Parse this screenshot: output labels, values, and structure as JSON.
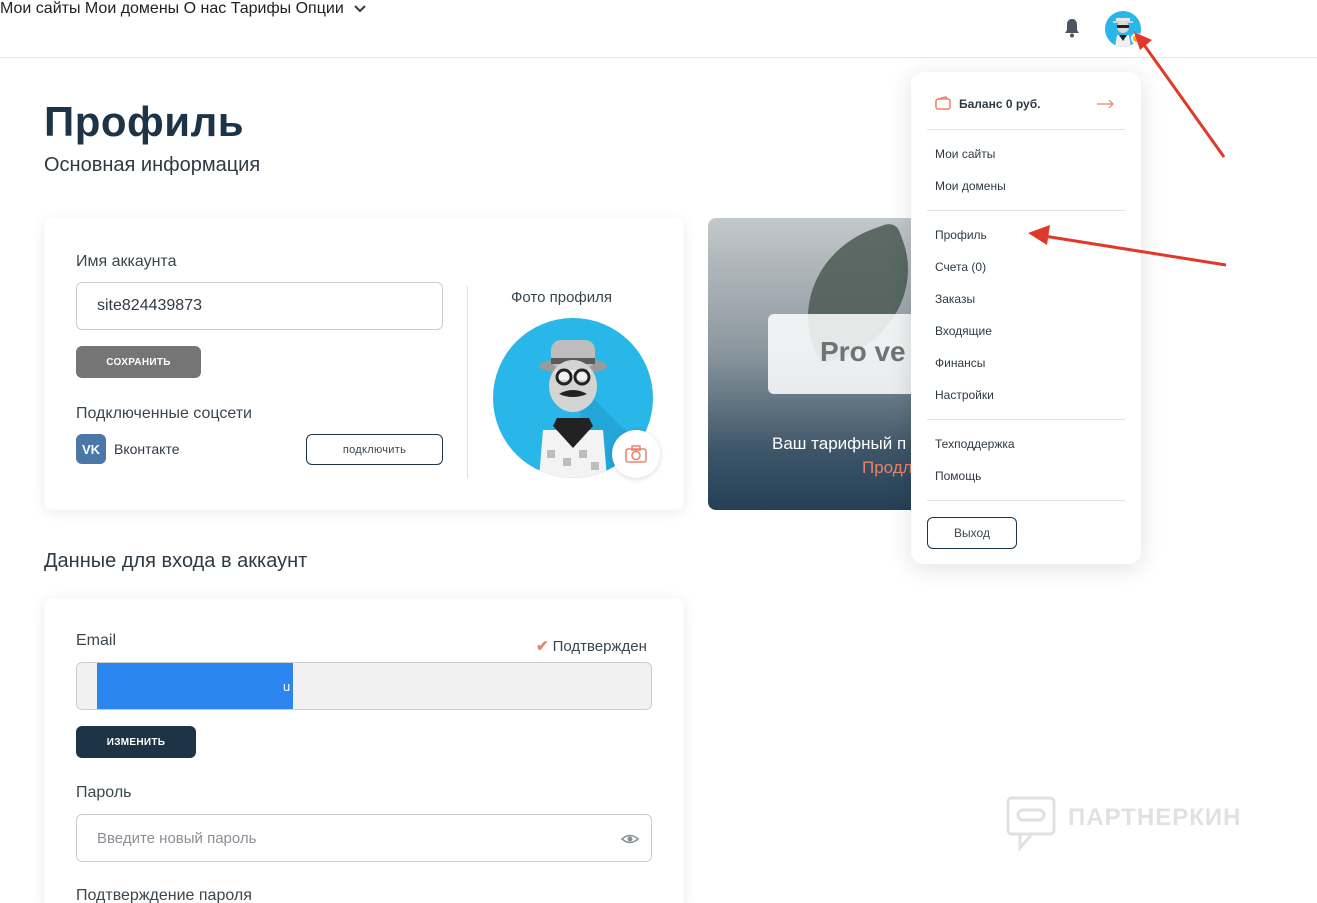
{
  "nav": {
    "my_sites": "Мои сайты",
    "my_domains": "Мои домены",
    "about": "О нас",
    "tariffs": "Тарифы",
    "options": "Опции",
    "bell_icon": "bell-icon",
    "avatar_icon": "avatar-icon"
  },
  "page": {
    "title": "Профиль",
    "subtitle": "Основная информация"
  },
  "profile_card": {
    "account_name_label": "Имя аккаунта",
    "account_name_value": "site824439873",
    "save_button": "СОХРАНИТЬ",
    "socials_label": "Подключенные соцсети",
    "vk_badge": "VK",
    "vk_label": "Вконтакте",
    "connect_button": "подключить",
    "photo_label": "Фото профиля",
    "camera_icon": "camera-icon"
  },
  "banner": {
    "pro_text": "Pro ve",
    "tariff_text": "Ваш тарифный п",
    "link_text": "Продл"
  },
  "login_section": {
    "title": "Данные для входа в аккаунт",
    "email_label": "Email",
    "email_value": "u",
    "confirmed_mark": "✔",
    "confirmed_text": "Подтвержден",
    "change_button": "ИЗМЕНИТЬ",
    "password_label": "Пароль",
    "password_placeholder": "Введите новый пароль",
    "confirm_password_label": "Подтверждение пароля",
    "eye_icon": "eye-icon"
  },
  "dropdown": {
    "balance": "Баланс 0 руб.",
    "wallet_icon": "wallet-icon",
    "arrow_icon": "arrow-right-icon",
    "items_group1": [
      "Мои сайты",
      "Мои домены"
    ],
    "items_group2": [
      "Профиль",
      "Счета (0)",
      "Заказы",
      "Входящие",
      "Финансы",
      "Настройки"
    ],
    "items_group3": [
      "Техподдержка",
      "Помощь"
    ],
    "logout": "Выход"
  },
  "watermark": {
    "text": "ПАРТНЕРКИН"
  },
  "colors": {
    "brand_dark": "#1d3447",
    "accent": "#e8846a",
    "avatar_bg": "#29b6e8",
    "annotation_arrow": "#e0392b"
  }
}
